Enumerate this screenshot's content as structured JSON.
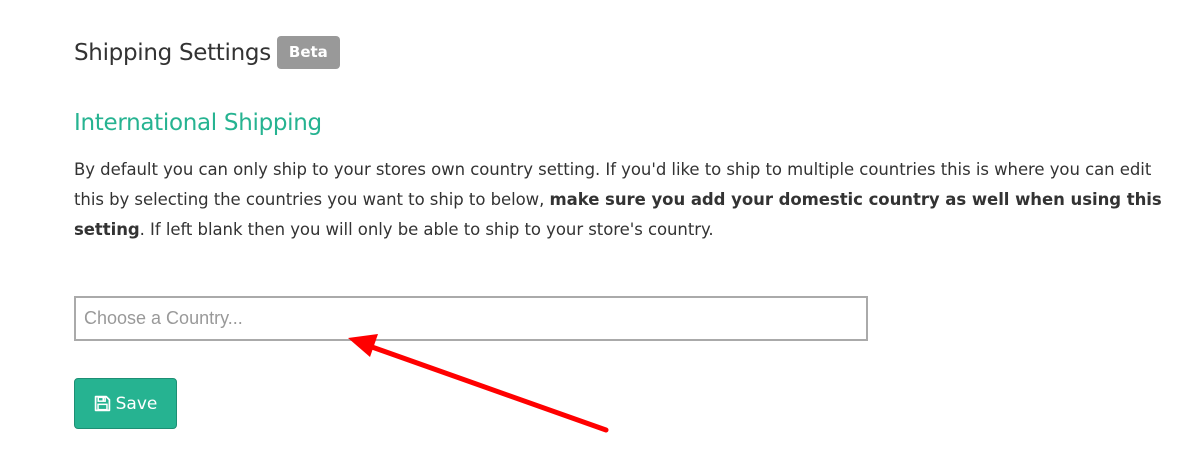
{
  "header": {
    "title": "Shipping Settings",
    "badge": "Beta"
  },
  "section": {
    "title": "International Shipping",
    "description_part1": "By default you can only ship to your stores own country setting. If you'd like to ship to multiple countries this is where you can edit this by selecting the countries you want to ship to below, ",
    "description_bold": "make sure you add your domestic country as well when using this setting",
    "description_part2": ". If left blank then you will only be able to ship to your store's country."
  },
  "country_select": {
    "placeholder": "Choose a Country..."
  },
  "save_button": {
    "label": "Save",
    "icon": "floppy-disk-icon"
  },
  "colors": {
    "accent": "#26b391",
    "badge": "#999999",
    "text": "#333333",
    "annotation": "#ff0000"
  }
}
